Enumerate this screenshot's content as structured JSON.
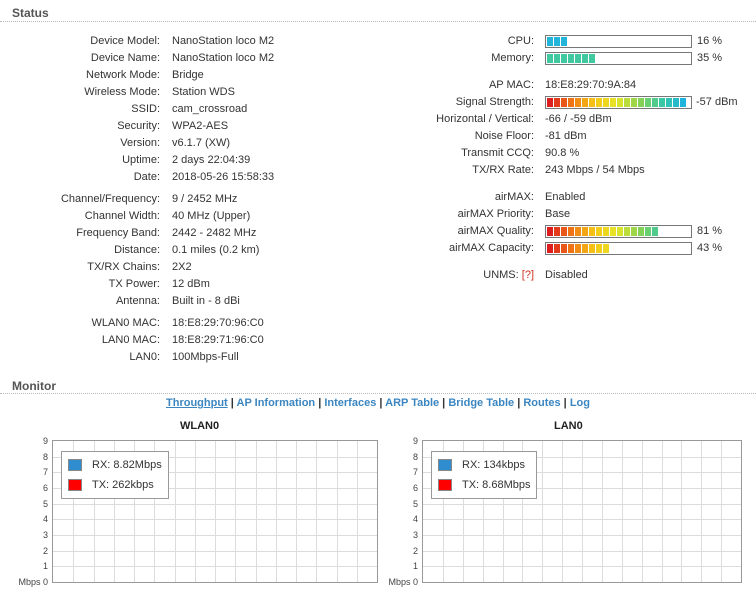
{
  "status": {
    "title": "Status",
    "left": [
      {
        "label": "Device Model:",
        "value": "NanoStation loco M2"
      },
      {
        "label": "Device Name:",
        "value": "NanoStation loco M2"
      },
      {
        "label": "Network Mode:",
        "value": "Bridge"
      },
      {
        "label": "Wireless Mode:",
        "value": "Station WDS"
      },
      {
        "label": "SSID:",
        "value": "cam_crossroad"
      },
      {
        "label": "Security:",
        "value": "WPA2-AES"
      },
      {
        "label": "Version:",
        "value": "v6.1.7 (XW)"
      },
      {
        "label": "Uptime:",
        "value": "2 days 22:04:39"
      },
      {
        "label": "Date:",
        "value": "2018-05-26 15:58:33"
      },
      {
        "label": "Channel/Frequency:",
        "value": "9 / 2452 MHz"
      },
      {
        "label": "Channel Width:",
        "value": "40 MHz (Upper)"
      },
      {
        "label": "Frequency Band:",
        "value": "2442 - 2482 MHz"
      },
      {
        "label": "Distance:",
        "value": "0.1 miles (0.2 km)"
      },
      {
        "label": "TX/RX Chains:",
        "value": "2X2"
      },
      {
        "label": "TX Power:",
        "value": "12 dBm"
      },
      {
        "label": "Antenna:",
        "value": "Built in - 8 dBi"
      },
      {
        "label": "WLAN0 MAC:",
        "value": "18:E8:29:70:96:C0"
      },
      {
        "label": "LAN0 MAC:",
        "value": "18:E8:29:71:96:C0"
      },
      {
        "label": "LAN0:",
        "value": "100Mbps-Full"
      }
    ],
    "cpu": {
      "label": "CPU:",
      "value": "16 %",
      "level": 0.16
    },
    "memory": {
      "label": "Memory:",
      "value": "35 %",
      "level": 0.35
    },
    "ap_mac": {
      "label": "AP MAC:",
      "value": "18:E8:29:70:9A:84"
    },
    "signal": {
      "label": "Signal Strength:",
      "value": "-57 dBm",
      "level": 1.0
    },
    "hv": {
      "label": "Horizontal / Vertical:",
      "value": "-66 / -59 dBm"
    },
    "noise": {
      "label": "Noise Floor:",
      "value": "-81 dBm"
    },
    "ccq": {
      "label": "Transmit CCQ:",
      "value": "90.8 %"
    },
    "rate": {
      "label": "TX/RX Rate:",
      "value": "243 Mbps / 54 Mbps"
    },
    "airmax": {
      "label": "airMAX:",
      "value": "Enabled"
    },
    "airmax_priority": {
      "label": "airMAX Priority:",
      "value": "Base"
    },
    "airmax_quality": {
      "label": "airMAX Quality:",
      "value": "81 %",
      "level": 0.81
    },
    "airmax_capacity": {
      "label": "airMAX Capacity:",
      "value": "43 %",
      "level": 0.43
    },
    "unms": {
      "label": "UNMS:",
      "link": "[?]",
      "value": "Disabled"
    }
  },
  "monitor": {
    "title": "Monitor",
    "tabs": [
      "Throughput",
      "AP Information",
      "Interfaces",
      "ARP Table",
      "Bridge Table",
      "Routes",
      "Log"
    ],
    "active_tab": "Throughput"
  },
  "charts": [
    {
      "title": "WLAN0",
      "unit": "Mbps",
      "y_ticks": [
        "0",
        "1",
        "2",
        "3",
        "4",
        "5",
        "6",
        "7",
        "8",
        "9"
      ],
      "legend": [
        {
          "name": "RX: 8.82Mbps",
          "color": "#2f8ccf"
        },
        {
          "name": "TX: 262kbps",
          "color": "#ff0000"
        }
      ]
    },
    {
      "title": "LAN0",
      "unit": "Mbps",
      "y_ticks": [
        "0",
        "1",
        "2",
        "3",
        "4",
        "5",
        "6",
        "7",
        "8",
        "9"
      ],
      "legend": [
        {
          "name": "RX: 134kbps",
          "color": "#2f8ccf"
        },
        {
          "name": "TX: 8.68Mbps",
          "color": "#ff0000"
        }
      ]
    }
  ],
  "colors": {
    "bar_blue": "#22b5d9",
    "bar_green": "#40c8a0"
  }
}
